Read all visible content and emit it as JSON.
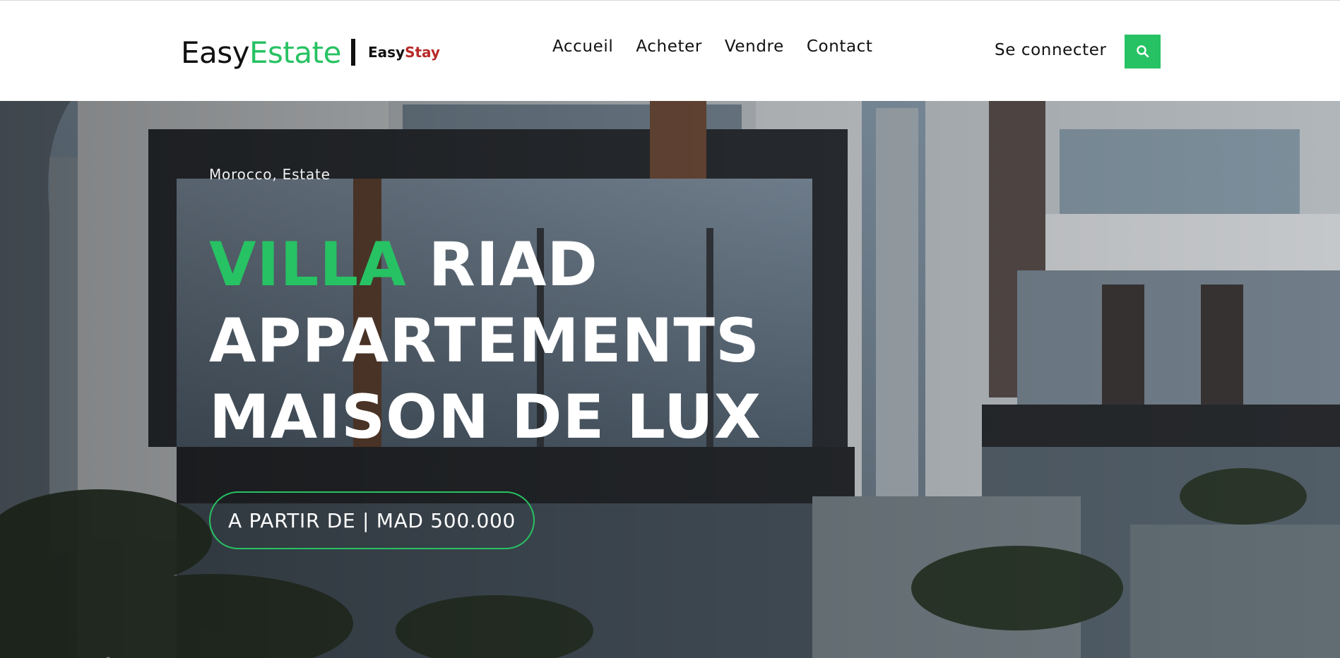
{
  "brand": {
    "name_part1": "Easy",
    "name_part2": "Estate",
    "sub_part1": "Easy",
    "sub_part2": "Stay"
  },
  "nav": {
    "items": [
      "Accueil",
      "Acheter",
      "Vendre",
      "Contact"
    ]
  },
  "header": {
    "login_label": "Se connecter",
    "search_icon": "search-icon"
  },
  "hero": {
    "location": "Morocco, Estate",
    "headline_accent": "VILLA",
    "headline_line1_rest": " RIAD",
    "headline_line2": "APPARTEMENTS",
    "headline_line3": "MAISON DE LUX",
    "price_label": "A PARTIR DE | MAD 500.000"
  },
  "colors": {
    "accent": "#27c263",
    "brand_secondary": "#b82a2a"
  }
}
